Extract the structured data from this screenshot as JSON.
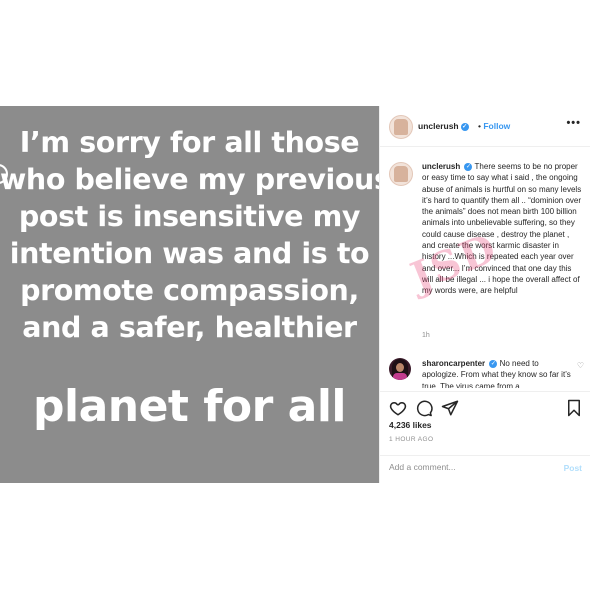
{
  "story": {
    "lines": [
      "I’m sorry for all those",
      "who believe my previous",
      "post is insensitive  my",
      "intention was and is to",
      "promote compassion,",
      "and a safer, healthier"
    ],
    "big_line": "planet for all"
  },
  "header": {
    "username": "unclerush",
    "verified_icon": "verified-badge-icon",
    "separator": "•",
    "follow_label": "Follow",
    "more_icon": "•••"
  },
  "caption": {
    "username": "unclerush",
    "text": "There seems to be no proper or easy time to say what i said , the ongoing abuse of animals is hurtful on so many levels it’s hard to quantify them all .. “dominion over the animals” does not mean birth 100 billion animals into unbelievable suffering, so they could cause disease , destroy the planet , and create the worst karmic disaster in history ...Which is repeated each year over and over... I’m convinced that one day this will all be illegal ... i hope the overall affect of my words were, are helpful",
    "time": "1h",
    "watermark": "JSD"
  },
  "comment": {
    "username": "sharoncarpenter",
    "text": "No need to apologize. From what they know so far it’s true. The virus came from a"
  },
  "actions": {
    "likes": "4,236 likes",
    "posted_ago": "1 HOUR AGO"
  },
  "add_comment": {
    "placeholder": "Add a comment...",
    "post_label": "Post"
  },
  "colors": {
    "story_bg": "#8c8c8c",
    "link_blue": "#3897f0",
    "post_disabled": "#b2dffc",
    "watermark": "#e8336d"
  }
}
